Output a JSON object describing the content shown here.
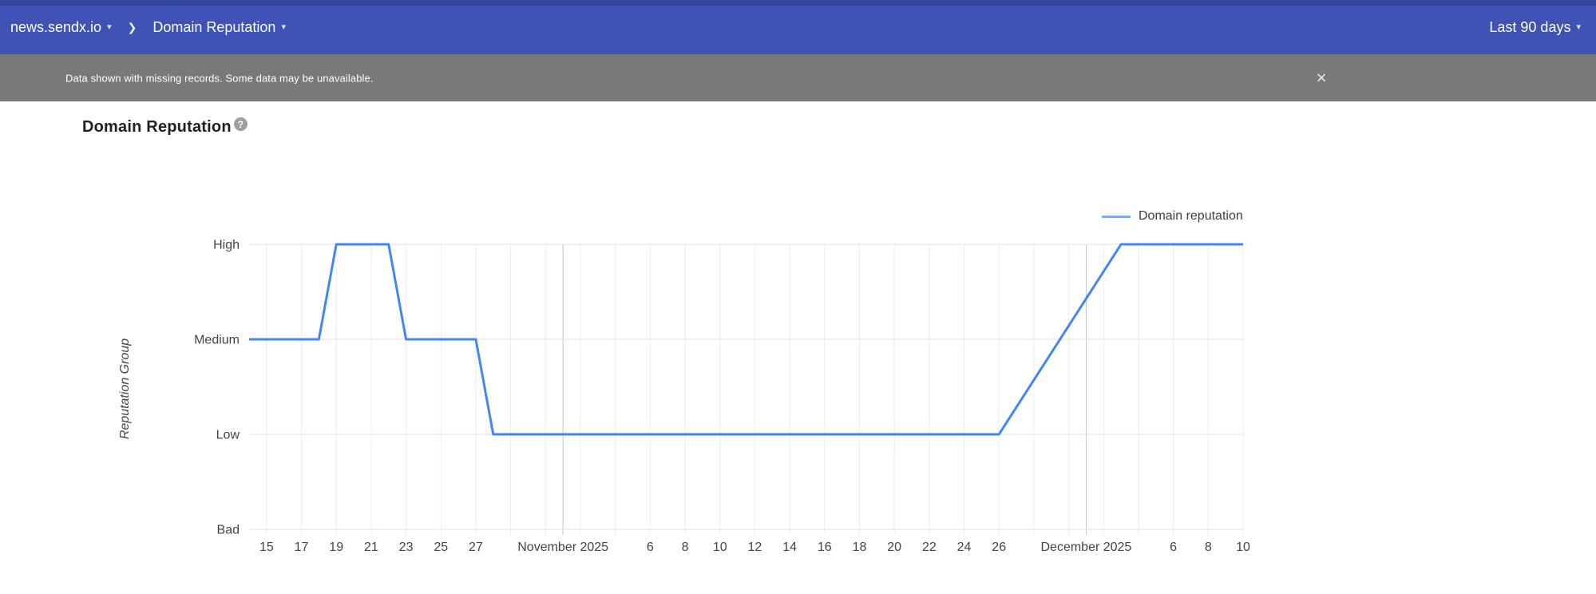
{
  "header": {
    "site": "news.sendx.io",
    "page": "Domain Reputation",
    "date_range": "Last 90 days"
  },
  "banner": {
    "message": "Data shown with missing records. Some data may be unavailable."
  },
  "page": {
    "title": "Domain Reputation"
  },
  "legend": {
    "label": "Domain reputation"
  },
  "icons": {
    "caret_down": "▾",
    "chevron_right": "❯",
    "close": "✕",
    "help": "?"
  },
  "colors": {
    "header_bg": "#3f52b5",
    "banner_bg": "#797979",
    "series_line": "#4285f4",
    "legend_swatch": "#7da7f7",
    "grid_horizontal": "#e0e0e0",
    "grid_vertical": "#ececec",
    "grid_month": "#c4c4c4",
    "axis_text": "#444444",
    "title_text": "#212121"
  },
  "chart_data": {
    "type": "line",
    "title": "Domain Reputation",
    "xlabel": "",
    "ylabel": "Reputation Group",
    "legend_position": "top-right",
    "grid": true,
    "y_categories": [
      "Bad",
      "Low",
      "Medium",
      "High"
    ],
    "value_map": {
      "Bad": 0,
      "Low": 1,
      "Medium": 2,
      "High": 3
    },
    "x_domain": {
      "start": "2025-10-14",
      "end": "2025-12-10",
      "days": 57
    },
    "x_ticks": [
      {
        "label": "15",
        "day": 1
      },
      {
        "label": "17",
        "day": 3
      },
      {
        "label": "19",
        "day": 5
      },
      {
        "label": "21",
        "day": 7
      },
      {
        "label": "23",
        "day": 9
      },
      {
        "label": "25",
        "day": 11
      },
      {
        "label": "27",
        "day": 13
      },
      {
        "label": "November 2025",
        "day": 18,
        "month": true
      },
      {
        "label": "6",
        "day": 23
      },
      {
        "label": "8",
        "day": 25
      },
      {
        "label": "10",
        "day": 27
      },
      {
        "label": "12",
        "day": 29
      },
      {
        "label": "14",
        "day": 31
      },
      {
        "label": "16",
        "day": 33
      },
      {
        "label": "18",
        "day": 35
      },
      {
        "label": "20",
        "day": 37
      },
      {
        "label": "22",
        "day": 39
      },
      {
        "label": "24",
        "day": 41
      },
      {
        "label": "26",
        "day": 43
      },
      {
        "label": "December 2025",
        "day": 48,
        "month": true
      },
      {
        "label": "6",
        "day": 53
      },
      {
        "label": "8",
        "day": 55
      },
      {
        "label": "10",
        "day": 57
      }
    ],
    "gridline_days": [
      1,
      3,
      5,
      7,
      9,
      11,
      13,
      15,
      17,
      19,
      21,
      23,
      25,
      27,
      29,
      31,
      33,
      35,
      37,
      39,
      41,
      43,
      45,
      47,
      49,
      51,
      53,
      55,
      57
    ],
    "month_gridline_days": [
      18,
      48
    ],
    "series": [
      {
        "name": "Domain reputation",
        "color": "#4285f4",
        "points": [
          {
            "date": "2025-10-14",
            "day": 0,
            "group": "Medium"
          },
          {
            "date": "2025-10-18",
            "day": 4,
            "group": "Medium"
          },
          {
            "date": "2025-10-19",
            "day": 5,
            "group": "High"
          },
          {
            "date": "2025-10-22",
            "day": 8,
            "group": "High"
          },
          {
            "date": "2025-10-23",
            "day": 9,
            "group": "Medium"
          },
          {
            "date": "2025-10-27",
            "day": 13,
            "group": "Medium"
          },
          {
            "date": "2025-10-28",
            "day": 14,
            "group": "Low"
          },
          {
            "date": "2025-11-26",
            "day": 43,
            "group": "Low"
          },
          {
            "date": "2025-12-03",
            "day": 50,
            "group": "High"
          },
          {
            "date": "2025-12-10",
            "day": 57,
            "group": "High"
          }
        ]
      }
    ]
  }
}
